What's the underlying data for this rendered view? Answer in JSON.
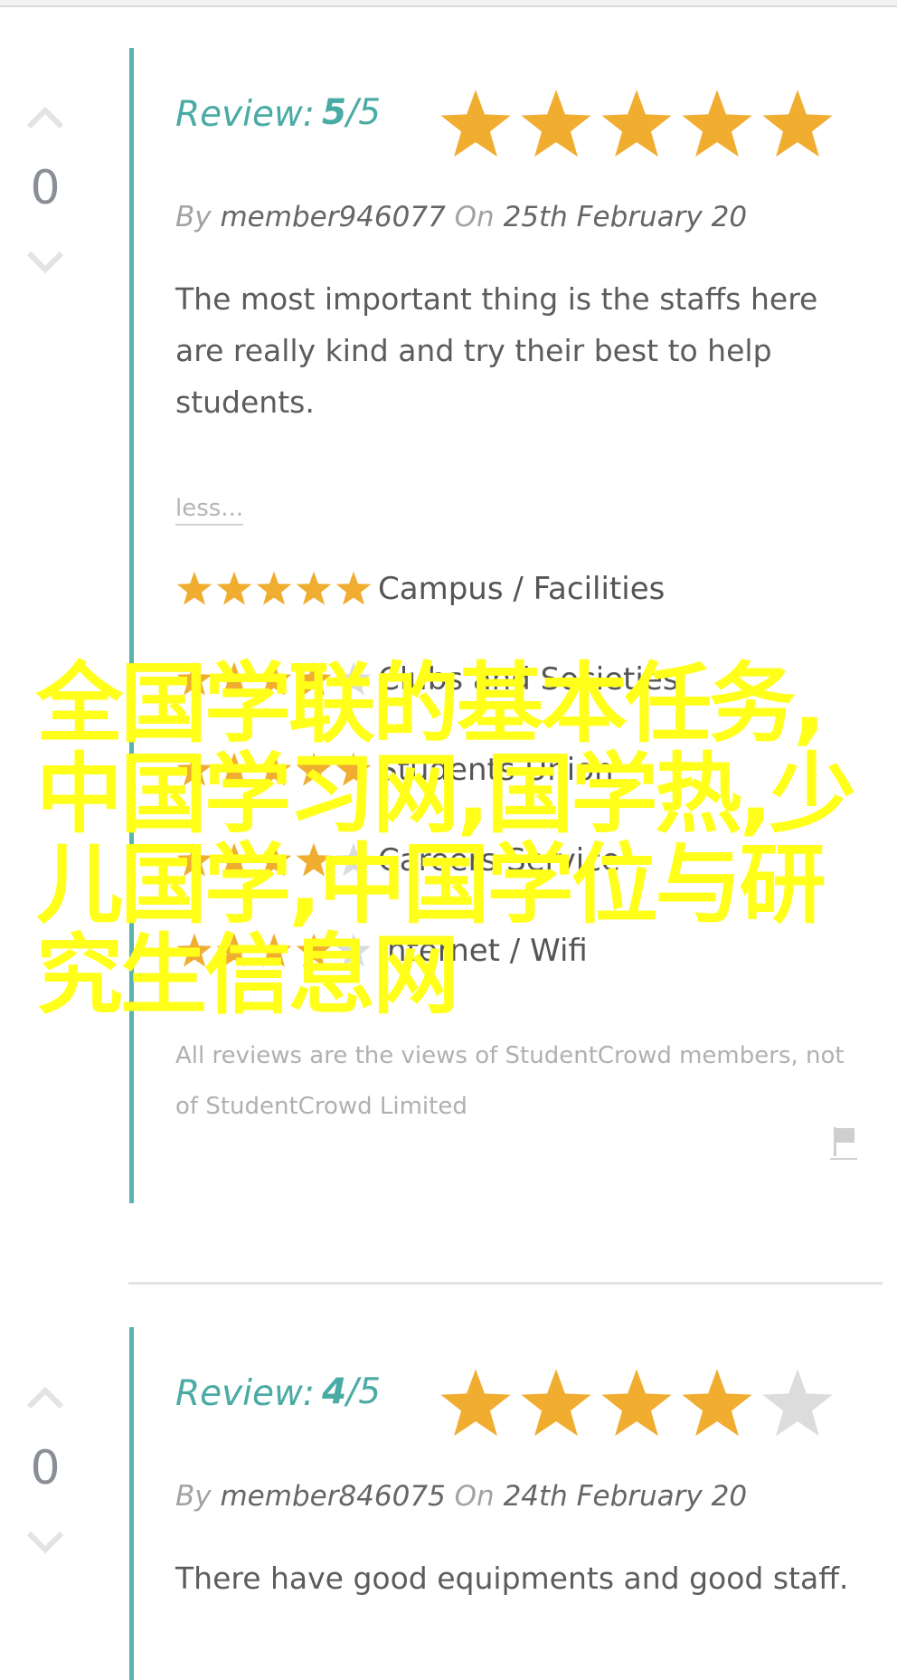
{
  "overlay_text": "全国学联的基本任务,中国学习网,国学热,少儿国学,中国学位与研究生信息网",
  "colors": {
    "accent": "#4aaba4",
    "star_gold": "#f0ad2f",
    "star_gray": "#dcdcdc",
    "overlay": "#ffff1a"
  },
  "icons": {
    "up": "chevron-up-icon",
    "down": "chevron-down-icon",
    "flag": "flag-icon",
    "star": "star-icon"
  },
  "reviews": [
    {
      "votes": "0",
      "review_label": "Review:",
      "score": "5",
      "score_max": "/5",
      "rating": 5,
      "by_label": "By",
      "member": "member946077",
      "on_label": "On",
      "date": "25th February 20",
      "text": "The most important thing is the staffs here are really kind and try their best to help students.",
      "less_link": "less...",
      "categories": [
        {
          "label": "Campus / Facilities",
          "rating": 5
        },
        {
          "label": "Clubs and Societies",
          "rating": 4
        },
        {
          "label": "Students Union",
          "rating": 5
        },
        {
          "label": "Careers Service",
          "rating": 4
        },
        {
          "label": "Internet / Wifi",
          "rating": 4
        }
      ],
      "disclaimer": "All reviews are the views of StudentCrowd members, not of StudentCrowd Limited"
    },
    {
      "votes": "0",
      "review_label": "Review:",
      "score": "4",
      "score_max": "/5",
      "rating": 4,
      "by_label": "By",
      "member": "member846075",
      "on_label": "On",
      "date": "24th February 20",
      "text": "There have good equipments and good staff."
    }
  ]
}
